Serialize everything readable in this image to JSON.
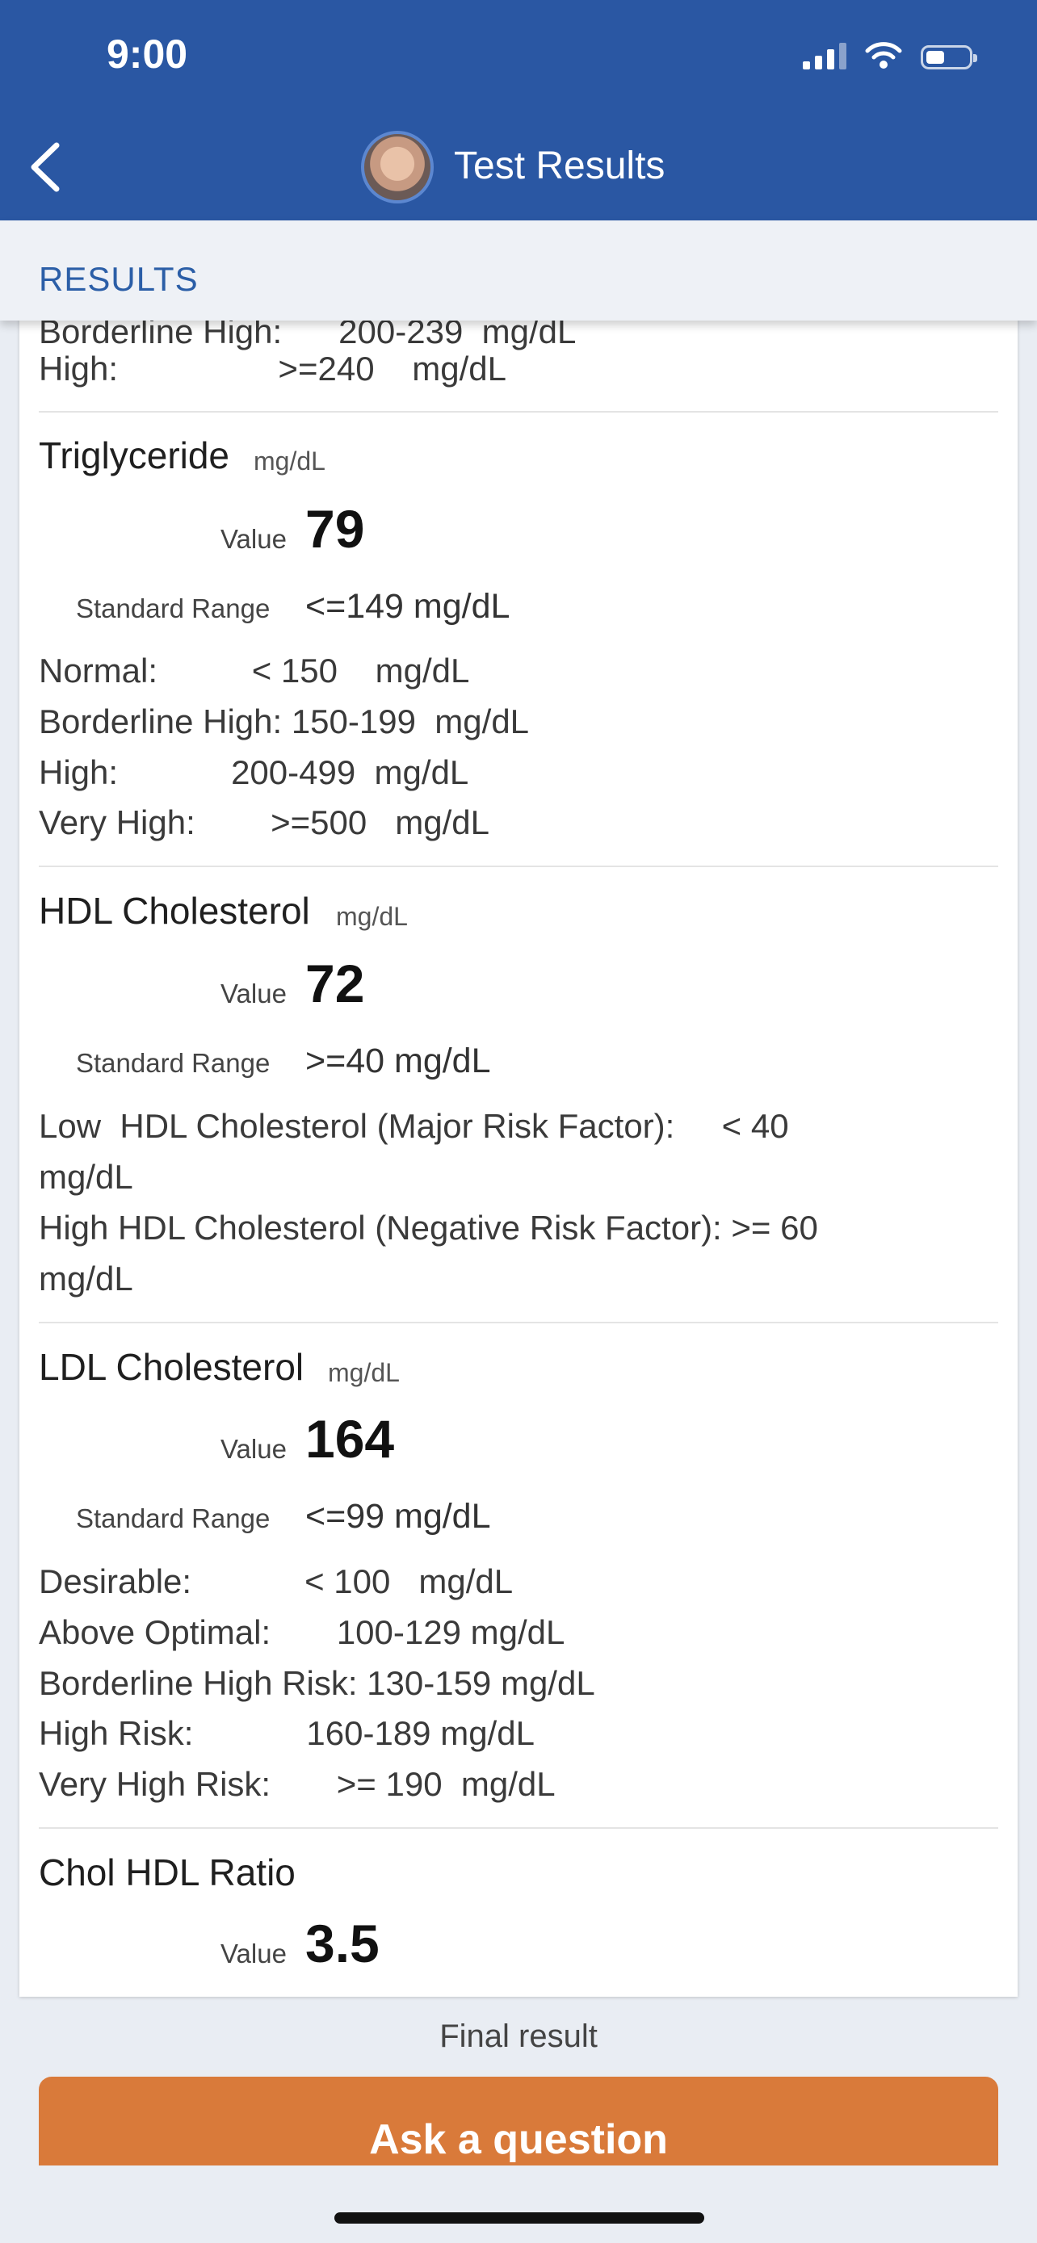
{
  "status_bar": {
    "time": "9:00"
  },
  "header": {
    "title": "Test Results"
  },
  "tabs": {
    "results": "RESULTS"
  },
  "cholesterol_tail": {
    "borderline_row": "Borderline High:      200-239  mg/dL",
    "high_row": "High:                 >=240    mg/dL"
  },
  "triglyceride": {
    "name": "Triglyceride",
    "unit": "mg/dL",
    "value_label": "Value",
    "value": "79",
    "range_label": "Standard Range",
    "range": "<=149 mg/dL",
    "notes": [
      "Normal:          < 150    mg/dL",
      "Borderline High: 150-199  mg/dL",
      "High:            200-499  mg/dL",
      "Very High:        >=500   mg/dL"
    ]
  },
  "hdl": {
    "name": "HDL Cholesterol",
    "unit": "mg/dL",
    "value_label": "Value",
    "value": "72",
    "range_label": "Standard Range",
    "range": ">=40 mg/dL",
    "notes": [
      "Low  HDL Cholesterol (Major Risk Factor):     < 40",
      "mg/dL",
      "High HDL Cholesterol (Negative Risk Factor): >= 60",
      "mg/dL"
    ]
  },
  "ldl": {
    "name": "LDL Cholesterol",
    "unit": "mg/dL",
    "value_label": "Value",
    "value": "164",
    "range_label": "Standard Range",
    "range": "<=99 mg/dL",
    "notes": [
      "Desirable:            < 100   mg/dL",
      "Above Optimal:       100-129 mg/dL",
      "Borderline High Risk: 130-159 mg/dL",
      "High Risk:            160-189 mg/dL",
      "Very High Risk:       >= 190  mg/dL"
    ]
  },
  "ratio": {
    "name": "Chol HDL Ratio",
    "value_label": "Value",
    "value": "3.5"
  },
  "footer": {
    "final": "Final result",
    "ask_button": "Ask a question"
  }
}
